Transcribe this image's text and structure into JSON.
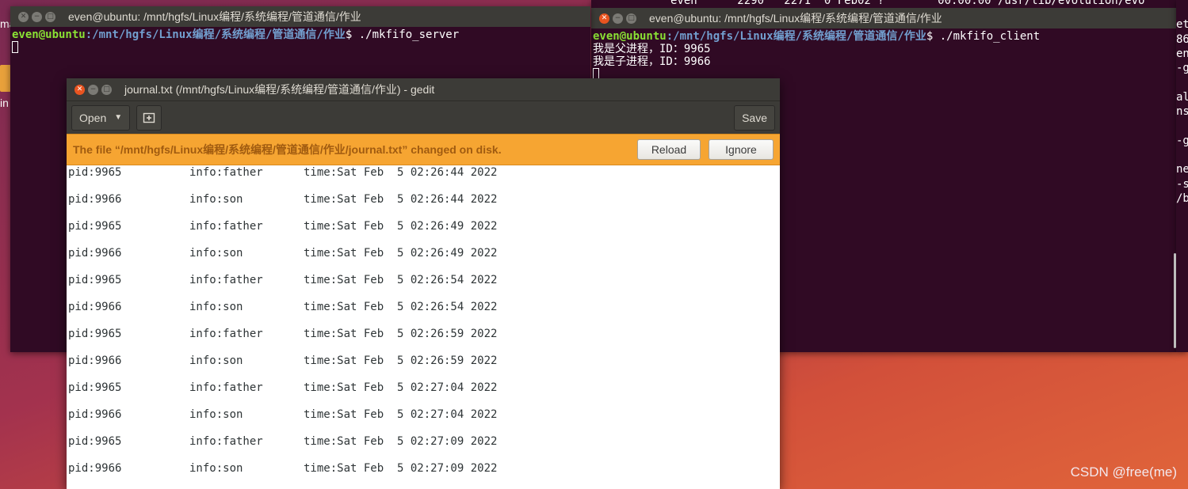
{
  "desktop": {
    "labels": [
      "ma",
      "in"
    ],
    "watermark": "CSDN @free(me)"
  },
  "terminal_left": {
    "title": "even@ubuntu: /mnt/hgfs/Linux编程/系统编程/管道通信/作业",
    "user": "even@ubuntu",
    "path": ":/mnt/hgfs/Linux编程/系统编程/管道通信/作业",
    "command": "$ ./mkfifo_server"
  },
  "terminal_right": {
    "top_line": "even      2290   2271  0 Feb02 ?        00:00:00 /usr/lib/evolution/evo",
    "title": "even@ubuntu: /mnt/hgfs/Linux编程/系统编程/管道通信/作业",
    "user": "even@ubuntu",
    "path": ":/mnt/hgfs/Linux编程/系统编程/管道通信/作业",
    "command": "$ ./mkfifo_client",
    "output": [
      "我是父进程，ID：9965",
      "我是子进程，ID：9966"
    ]
  },
  "terminal_far_right_fragments": [
    "et",
    "86",
    "en",
    "-g",
    "",
    "al",
    "ns",
    "",
    "-g",
    "",
    "ne",
    "-s",
    "/b"
  ],
  "gedit": {
    "title": "journal.txt (/mnt/hgfs/Linux编程/系统编程/管道通信/作业) - gedit",
    "open_label": "Open",
    "save_label": "Save",
    "infobar_message": "The file “/mnt/hgfs/Linux编程/系统编程/管道通信/作业/journal.txt” changed on disk.",
    "reload_label": "Reload",
    "ignore_label": "Ignore",
    "lines": [
      {
        "pid": "pid:9965",
        "info": "info:father",
        "time": "time:Sat Feb  5 02:26:44 2022"
      },
      {
        "pid": "pid:9966",
        "info": "info:son",
        "time": "time:Sat Feb  5 02:26:44 2022"
      },
      {
        "pid": "pid:9965",
        "info": "info:father",
        "time": "time:Sat Feb  5 02:26:49 2022"
      },
      {
        "pid": "pid:9966",
        "info": "info:son",
        "time": "time:Sat Feb  5 02:26:49 2022"
      },
      {
        "pid": "pid:9965",
        "info": "info:father",
        "time": "time:Sat Feb  5 02:26:54 2022"
      },
      {
        "pid": "pid:9966",
        "info": "info:son",
        "time": "time:Sat Feb  5 02:26:54 2022"
      },
      {
        "pid": "pid:9965",
        "info": "info:father",
        "time": "time:Sat Feb  5 02:26:59 2022"
      },
      {
        "pid": "pid:9966",
        "info": "info:son",
        "time": "time:Sat Feb  5 02:26:59 2022"
      },
      {
        "pid": "pid:9965",
        "info": "info:father",
        "time": "time:Sat Feb  5 02:27:04 2022"
      },
      {
        "pid": "pid:9966",
        "info": "info:son",
        "time": "time:Sat Feb  5 02:27:04 2022"
      },
      {
        "pid": "pid:9965",
        "info": "info:father",
        "time": "time:Sat Feb  5 02:27:09 2022"
      },
      {
        "pid": "pid:9966",
        "info": "info:son",
        "time": "time:Sat Feb  5 02:27:09 2022"
      }
    ]
  }
}
